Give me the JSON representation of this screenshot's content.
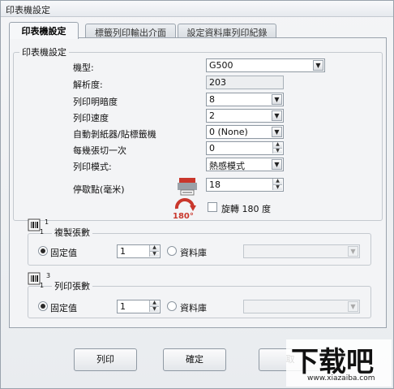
{
  "window": {
    "title": "印表機設定"
  },
  "tabs": [
    {
      "label": "印表機設定",
      "active": true
    },
    {
      "label": "標籤列印輸出介面",
      "active": false
    },
    {
      "label": "設定資料庫列印紀錄",
      "active": false
    }
  ],
  "printer_settings": {
    "group_title": "印表機設定",
    "model": {
      "label": "機型:",
      "value": "G500"
    },
    "resolution": {
      "label": "解析度:",
      "value": "203"
    },
    "darkness": {
      "label": "列印明暗度",
      "value": "8"
    },
    "speed": {
      "label": "列印速度",
      "value": "2"
    },
    "auto_cutter": {
      "label": "自動剝紙器/貼標籤機",
      "value": "0 (None)"
    },
    "cut_every": {
      "label": "每幾張切一次",
      "value": "0"
    },
    "print_mode": {
      "label": "列印模式:",
      "value": "熱感模式"
    },
    "stop_point": {
      "label": "停歇點(毫米)",
      "value": "18"
    },
    "rotate": {
      "label": "旋轉 180 度",
      "badge": "180°",
      "checked": false
    }
  },
  "copies": {
    "group_title": "複製張數",
    "icon_sup": "1",
    "icon_sub": "1",
    "fixed_label": "固定值",
    "fixed_value": "1",
    "database_label": "資料庫"
  },
  "print_count": {
    "group_title": "列印張數",
    "icon_sup": "3",
    "icon_sub": "1",
    "fixed_label": "固定值",
    "fixed_value": "1",
    "database_label": "資料庫"
  },
  "buttons": {
    "print": "列印",
    "ok": "確定",
    "cancel": "取"
  },
  "watermark": {
    "brand": "下载吧",
    "url": "www.xiazaiba.com"
  }
}
